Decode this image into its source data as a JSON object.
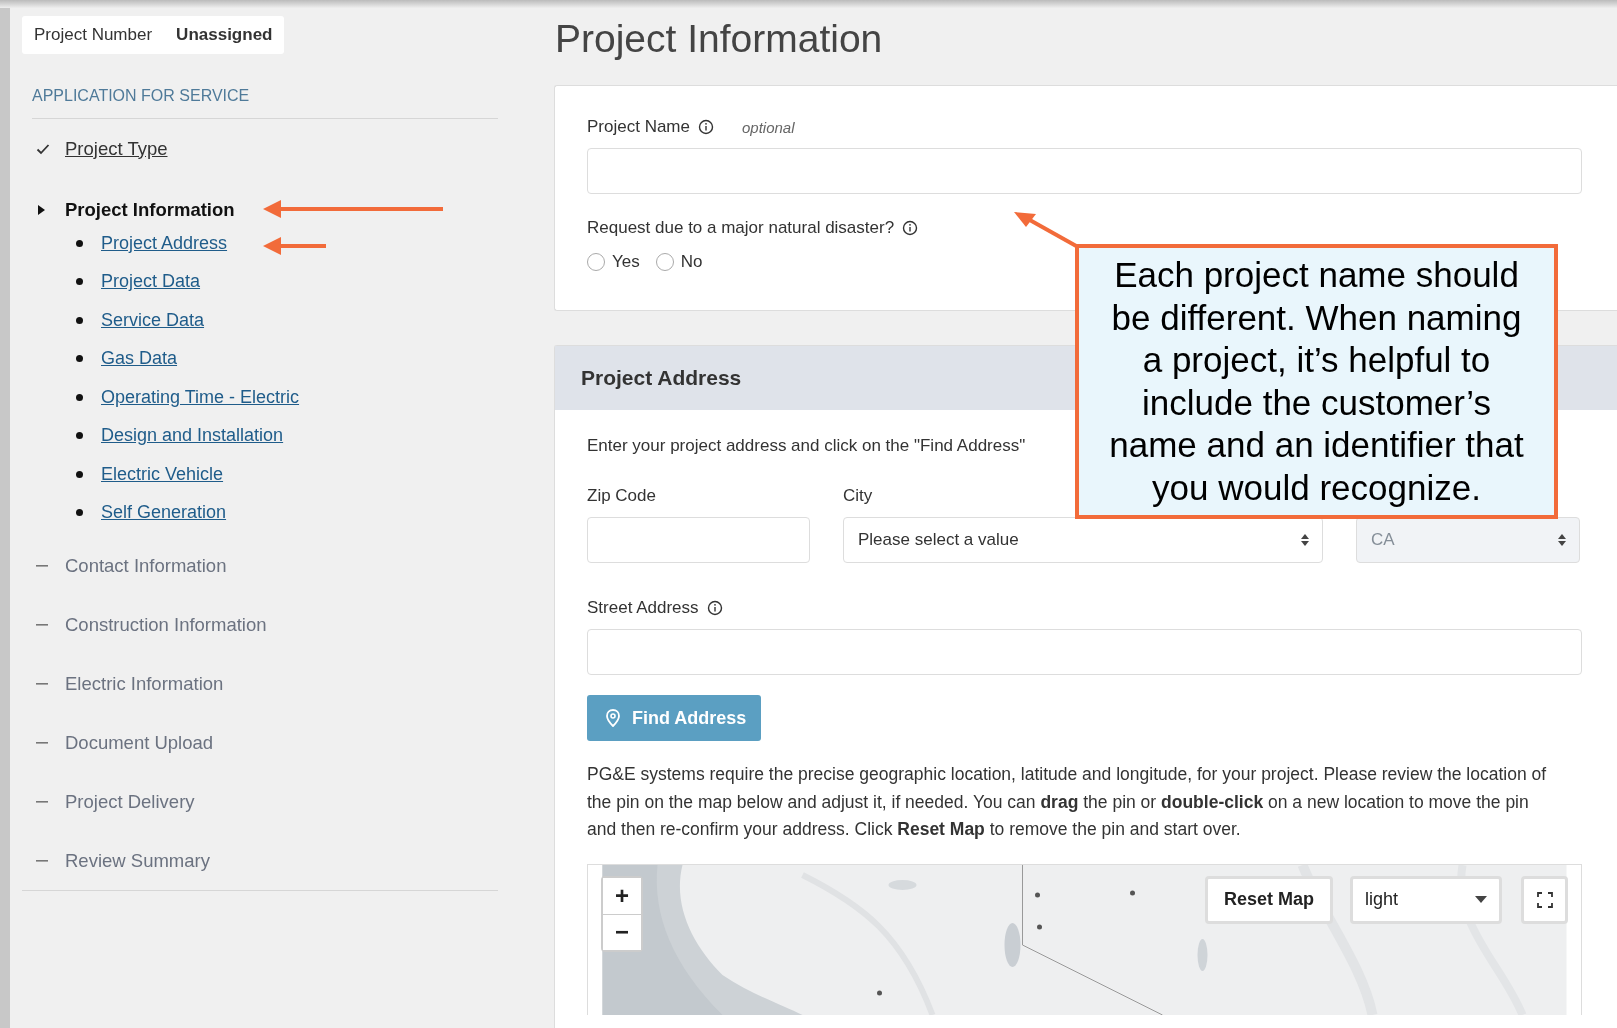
{
  "project_number": {
    "label": "Project Number",
    "value": "Unassigned"
  },
  "sidebar": {
    "heading": "APPLICATION FOR SERVICE",
    "items": [
      {
        "label": "Project Type",
        "kind": "done"
      },
      {
        "label": "Project Information",
        "kind": "current",
        "children": [
          {
            "label": "Project Address"
          },
          {
            "label": "Project Data"
          },
          {
            "label": "Service Data"
          },
          {
            "label": "Gas Data"
          },
          {
            "label": "Operating Time - Electric"
          },
          {
            "label": "Design and Installation"
          },
          {
            "label": "Electric Vehicle"
          },
          {
            "label": "Self Generation"
          }
        ]
      },
      {
        "label": "Contact Information",
        "kind": "pending"
      },
      {
        "label": "Construction Information",
        "kind": "pending"
      },
      {
        "label": "Electric Information",
        "kind": "pending"
      },
      {
        "label": "Document Upload",
        "kind": "pending"
      },
      {
        "label": "Project Delivery",
        "kind": "pending"
      },
      {
        "label": "Review Summary",
        "kind": "pending"
      }
    ]
  },
  "page_title": "Project Information",
  "project_name": {
    "label": "Project Name",
    "hint": "optional"
  },
  "disaster": {
    "label": "Request due to a major natural disaster?",
    "options": [
      {
        "label": "Yes",
        "selected": false
      },
      {
        "label": "No",
        "selected": false
      }
    ]
  },
  "address": {
    "title": "Project Address",
    "instructions": "Enter your project address and click on the \"Find Address\"",
    "fields": [
      {
        "label": "Zip Code",
        "kind": "text"
      },
      {
        "label": "City",
        "kind": "select",
        "value": "Please select a value",
        "disabled": false
      },
      {
        "kind": "select",
        "value": "CA",
        "disabled": true
      }
    ],
    "street": {
      "label": "Street Address"
    },
    "find_button": "Find Address",
    "note": "PG&E systems require the precise geographic location, latitude and longitude, for your project. Please review the location of the pin on the map below and adjust it, if needed. You can **drag** the pin or **double-click** on a new location to move the pin and then re-confirm your address. Click **Reset Map** to remove the pin and start over.",
    "map": {
      "kind": "picture",
      "zoom_in": "+",
      "zoom_out": "−",
      "reset_button": "Reset Map",
      "style": "light"
    }
  },
  "callout": {
    "text": "Each project name should be different. When naming a project, it’s helpful to include the customer’s name and an identifier that you would recognize."
  }
}
